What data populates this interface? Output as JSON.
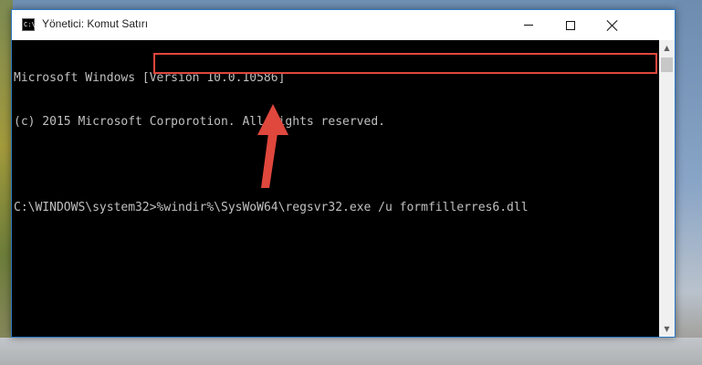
{
  "window": {
    "title": "Yönetici: Komut Satırı",
    "icon_text": "C:\\."
  },
  "console": {
    "line1": "Microsoft Windows [Version 10.0.10586]",
    "line2": "(c) 2015 Microsoft Corporotion. All rights reserved.",
    "prompt": "C:\\WINDOWS\\system32>",
    "command": "%windir%\\SysWoW64\\regsvr32.exe /u formfillerres6.dll"
  },
  "colors": {
    "highlight": "#e0473d",
    "arrow": "#e0473d",
    "console_bg": "#000000",
    "console_text": "#c0c0c0"
  },
  "icons": {
    "minimize": "minimize-icon",
    "maximize": "maximize-icon",
    "close": "close-icon",
    "app": "cmd-app-icon",
    "annotation": "arrow-up-icon"
  }
}
